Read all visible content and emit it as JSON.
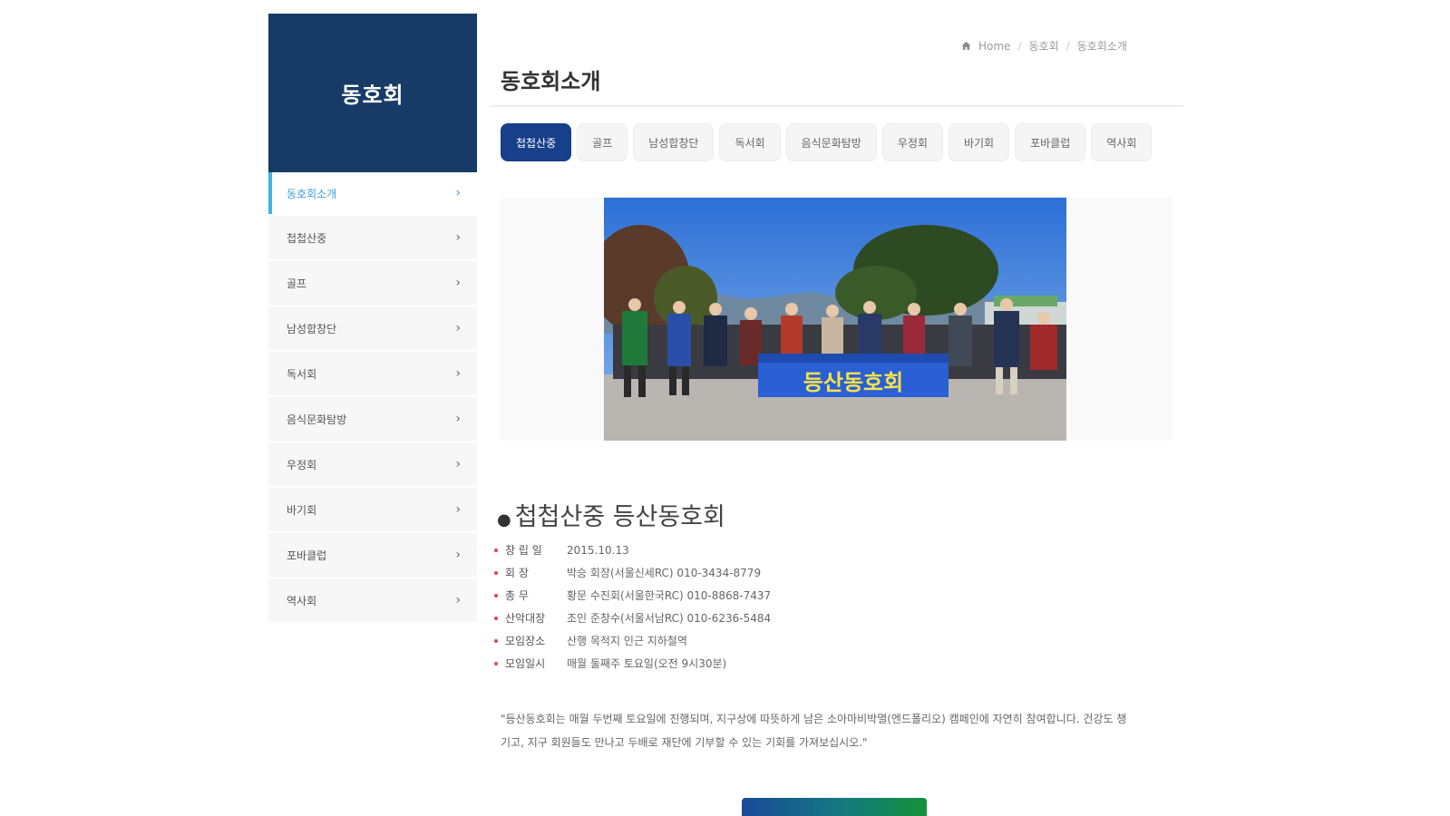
{
  "sidebar": {
    "title": "동호회",
    "items": [
      {
        "label": "동호회소개",
        "active": true
      },
      {
        "label": "첩첩산중"
      },
      {
        "label": "골프"
      },
      {
        "label": "남성합창단"
      },
      {
        "label": "독서회"
      },
      {
        "label": "음식문화탐방"
      },
      {
        "label": "우정회"
      },
      {
        "label": "바기회"
      },
      {
        "label": "포바클럽"
      },
      {
        "label": "역사회"
      }
    ]
  },
  "breadcrumb": {
    "home": "Home",
    "level1": "동호회",
    "level2": "동호회소개",
    "separator": "/"
  },
  "page": {
    "title": "동호회소개"
  },
  "tabs": [
    {
      "label": "첩첩산중",
      "active": true
    },
    {
      "label": "골프"
    },
    {
      "label": "남성합창단"
    },
    {
      "label": "독서회"
    },
    {
      "label": "음식문화탐방"
    },
    {
      "label": "우정회"
    },
    {
      "label": "바기회"
    },
    {
      "label": "포바클럽"
    },
    {
      "label": "역사회"
    }
  ],
  "photo": {
    "banner_text": "등산동호회"
  },
  "club": {
    "title": "첩첩산중 등산동호회",
    "info": [
      {
        "key": "창 립 일",
        "value": "2015.10.13"
      },
      {
        "key": "회 장",
        "value": "박승 회장(서울신세RC) 010-3434-8779"
      },
      {
        "key": "총 무",
        "value": "황문 수진회(서울한국RC) 010-8868-7437"
      },
      {
        "key": "산악대장",
        "value": "조인 준창수(서울서남RC) 010-6236-5484"
      },
      {
        "key": "모임장소",
        "value": "산행 목적지 인근 지하철역"
      },
      {
        "key": "모임일시",
        "value": "매월 둘째주 토요일(오전 9시30분)"
      }
    ],
    "description": "\"등산동호회는 매월 두번째 토요일에 진행되며, 지구상에 따뜻하게 남은 소아마비박멸(엔드폴리오) 캠페인에 자연히 참여합니다. 건강도 챙기고, 지구 회원들도 만나고 두배로 재단에 기부할 수 있는 기회를 가져보십시오.\""
  },
  "colors": {
    "sidebar_header": "#173a66",
    "active_tab": "#173f8a",
    "sidebar_active": "#3fb2e3",
    "bullet": "#e0454a"
  }
}
